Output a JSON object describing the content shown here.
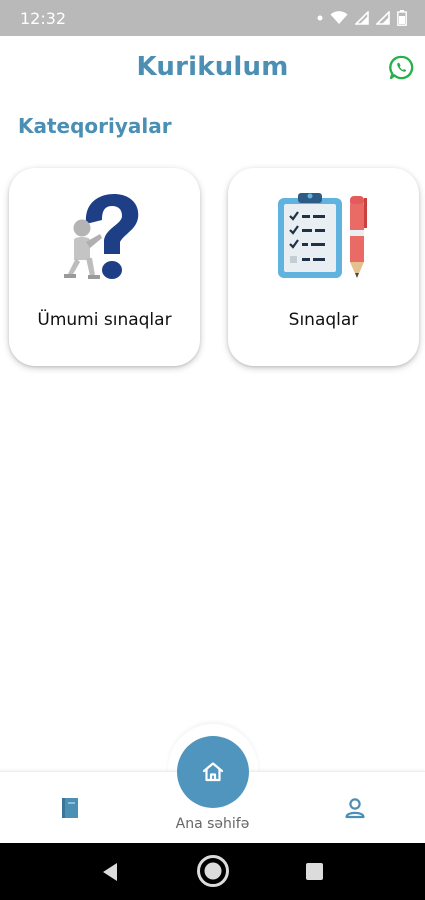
{
  "status_bar": {
    "time": "12:32",
    "icons": [
      "dot-icon",
      "wifi-icon",
      "signal-icon",
      "signal-icon",
      "battery-icon"
    ]
  },
  "header": {
    "title": "Kurikulum",
    "action_icon": "whatsapp-icon"
  },
  "section": {
    "title": "Kateqoriyalar"
  },
  "categories": [
    {
      "label": "Ümumi sınaqlar",
      "icon": "question-mark-figure-icon"
    },
    {
      "label": "Sınaqlar",
      "icon": "clipboard-checklist-icon"
    }
  ],
  "bottom_nav": {
    "home_label": "Ana səhifə",
    "items": [
      "book-icon",
      "home-icon",
      "profile-icon"
    ]
  },
  "colors": {
    "accent": "#4b8fb4",
    "fab": "#5095bd",
    "whatsapp": "#25b04a",
    "status_bar": "#b9b9b9"
  }
}
